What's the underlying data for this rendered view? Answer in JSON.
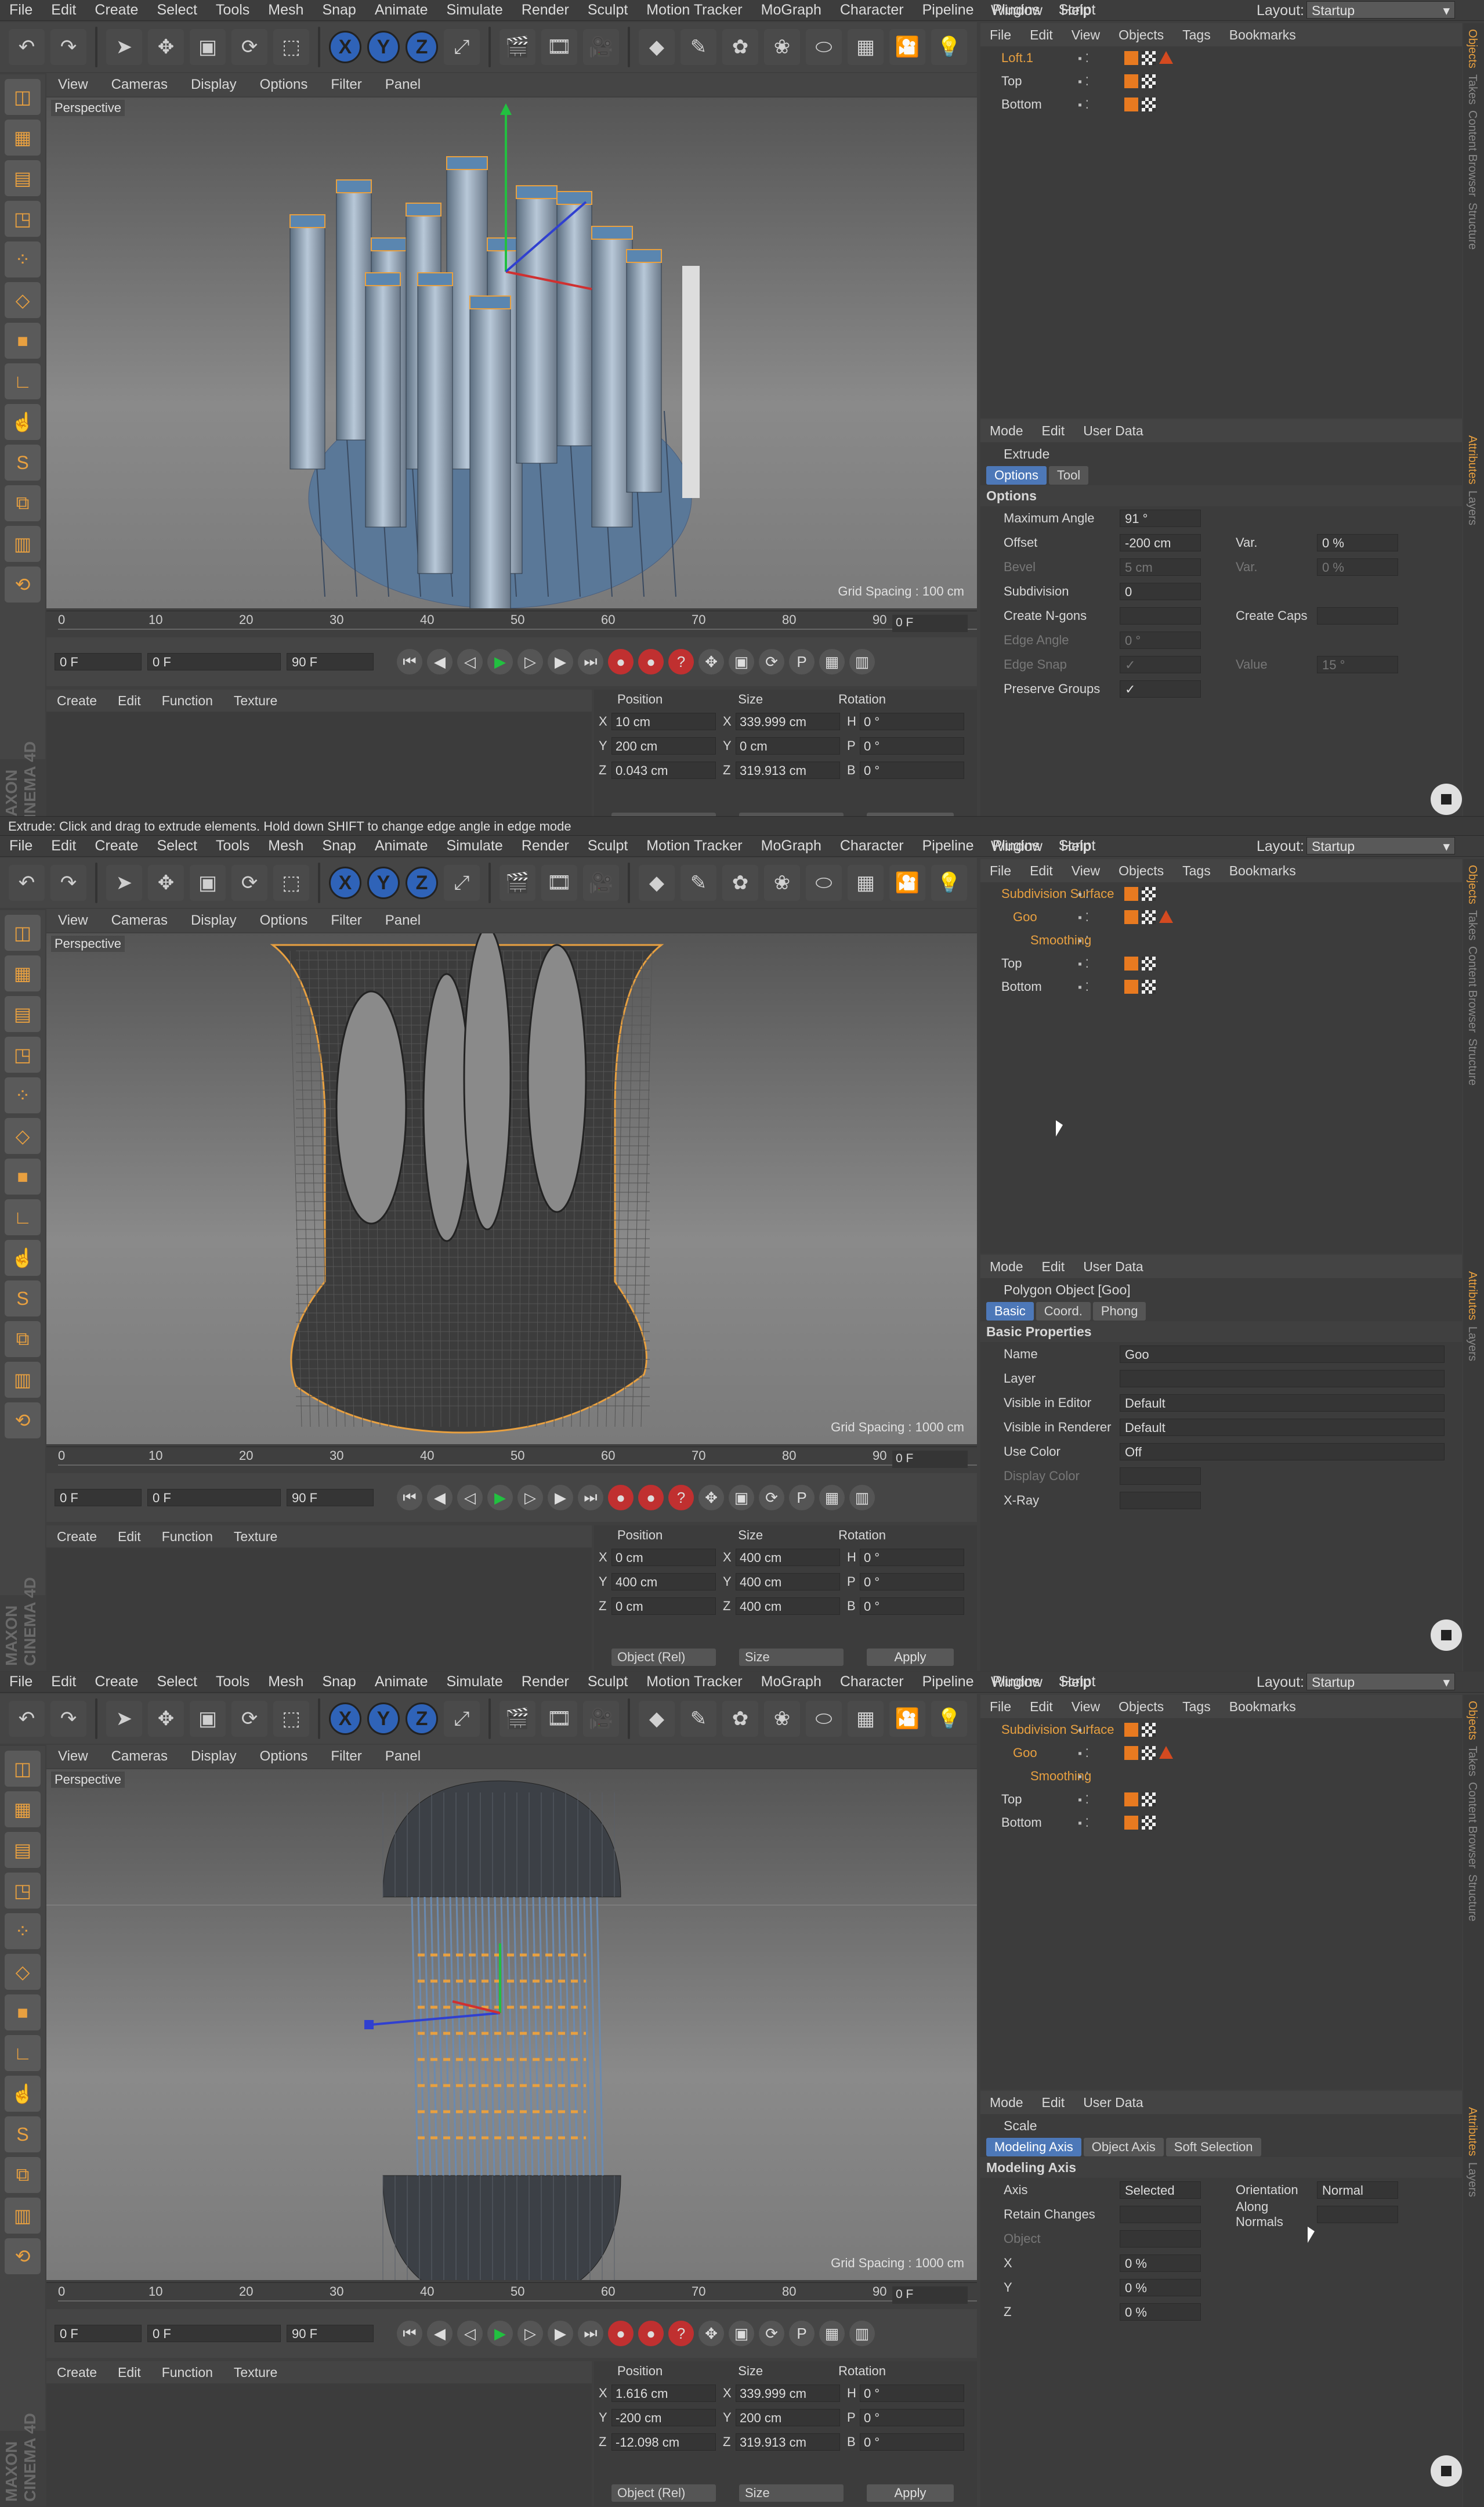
{
  "menu": [
    "File",
    "Edit",
    "Create",
    "Select",
    "Tools",
    "Mesh",
    "Snap",
    "Animate",
    "Simulate",
    "Render",
    "Sculpt",
    "Motion Tracker",
    "MoGraph",
    "Character",
    "Pipeline",
    "Plugins",
    "Script"
  ],
  "menu_right": [
    "Window",
    "Help"
  ],
  "layout_label": "Layout:",
  "layout_value": "Startup",
  "vp_menu": [
    "View",
    "Cameras",
    "Display",
    "Options",
    "Filter",
    "Panel"
  ],
  "vp_label": "Perspective",
  "obj_menu": [
    "File",
    "Edit",
    "View",
    "Objects",
    "Tags",
    "Bookmarks"
  ],
  "attr_menu": [
    "Mode",
    "Edit",
    "User Data"
  ],
  "mat_menu": [
    "Create",
    "Edit",
    "Function",
    "Texture"
  ],
  "coord_hdr": [
    "Position",
    "Size",
    "Rotation"
  ],
  "timeline_ticks": [
    "0",
    "10",
    "20",
    "30",
    "40",
    "50",
    "60",
    "70",
    "80",
    "90"
  ],
  "frame_end": "0 F",
  "transport": {
    "start": "0 F",
    "min": "0 F",
    "max": "90 F",
    "end": "90 F"
  },
  "apply": "Apply",
  "coord_mode": "Object (Rel)",
  "size_mode": "Size",
  "side_tabs": [
    "Objects",
    "Takes",
    "Content Browser",
    "Structure"
  ],
  "side_tabs2": [
    "Attributes",
    "Layers"
  ],
  "maxon": "MAXON CINEMA 4D",
  "status1": "Extrude: Click and drag to extrude elements. Hold down SHIFT to change edge angle in edge mode",
  "screens": [
    {
      "grid": "Grid Spacing : 100 cm",
      "objects": [
        {
          "name": "Loft.1",
          "color": "#e8a040"
        },
        {
          "name": "Top",
          "color": "#d8d8d8"
        },
        {
          "name": "Bottom",
          "color": "#d8d8d8"
        }
      ],
      "attr_title": "Extrude",
      "attr_tabs": [
        "Options",
        "Tool"
      ],
      "section": "Options",
      "rows": [
        {
          "label": "Maximum Angle",
          "value": "91 °"
        },
        {
          "label": "Offset",
          "value": "-200 cm",
          "label2": "Var.",
          "value2": "0 %"
        },
        {
          "label": "Bevel",
          "value": "5 cm",
          "label2": "Var.",
          "value2": "0 %",
          "dim": true
        },
        {
          "label": "Subdivision",
          "value": "0"
        },
        {
          "label": "Create N-gons",
          "value": "",
          "label2": "Create Caps",
          "value2": ""
        },
        {
          "label": "Edge Angle",
          "value": "0 °",
          "dim": true
        },
        {
          "label": "Edge Snap",
          "value": "✓",
          "label2": "Value",
          "value2": "15 °",
          "dim": true
        },
        {
          "label": "Preserve Groups",
          "value": "✓"
        }
      ],
      "coords": {
        "x": [
          "X",
          "10 cm",
          "X",
          "339.999 cm",
          "H",
          "0 °"
        ],
        "y": [
          "Y",
          "200 cm",
          "Y",
          "0 cm",
          "P",
          "0 °"
        ],
        "z": [
          "Z",
          "0.043 cm",
          "Z",
          "319.913 cm",
          "B",
          "0 °"
        ]
      }
    },
    {
      "grid": "Grid Spacing : 1000 cm",
      "objects": [
        {
          "name": "Subdivision Surface",
          "color": "#e8a040"
        },
        {
          "name": "Goo",
          "color": "#e8a040"
        },
        {
          "name": "Smoothing",
          "color": "#e8a040"
        },
        {
          "name": "Top",
          "color": "#d8d8d8"
        },
        {
          "name": "Bottom",
          "color": "#d8d8d8"
        }
      ],
      "attr_title": "Polygon Object [Goo]",
      "attr_tabs": [
        "Basic",
        "Coord.",
        "Phong"
      ],
      "section": "Basic Properties",
      "rows": [
        {
          "label": "Name",
          "value": "Goo"
        },
        {
          "label": "Layer",
          "value": ""
        },
        {
          "label": "Visible in Editor",
          "value": "Default"
        },
        {
          "label": "Visible in Renderer",
          "value": "Default"
        },
        {
          "label": "Use Color",
          "value": "Off"
        },
        {
          "label": "Display Color",
          "value": "",
          "dim": true
        },
        {
          "label": "X-Ray",
          "value": ""
        }
      ],
      "coords": {
        "x": [
          "X",
          "0 cm",
          "X",
          "400 cm",
          "H",
          "0 °"
        ],
        "y": [
          "Y",
          "400 cm",
          "Y",
          "400 cm",
          "P",
          "0 °"
        ],
        "z": [
          "Z",
          "0 cm",
          "Z",
          "400 cm",
          "B",
          "0 °"
        ]
      }
    },
    {
      "grid": "Grid Spacing : 1000 cm",
      "objects": [
        {
          "name": "Subdivision Surface",
          "color": "#e8a040"
        },
        {
          "name": "Goo",
          "color": "#e8a040"
        },
        {
          "name": "Smoothing",
          "color": "#e8a040"
        },
        {
          "name": "Top",
          "color": "#d8d8d8"
        },
        {
          "name": "Bottom",
          "color": "#d8d8d8"
        }
      ],
      "attr_title": "Scale",
      "attr_tabs": [
        "Modeling Axis",
        "Object Axis",
        "Soft Selection"
      ],
      "section": "Modeling Axis",
      "rows": [
        {
          "label": "Axis",
          "value": "Selected",
          "label2": "Orientation",
          "value2": "Normal"
        },
        {
          "label": "Retain Changes",
          "value": "",
          "label2": "Along Normals",
          "value2": ""
        },
        {
          "label": "Object",
          "value": "",
          "dim": true
        },
        {
          "label": "X",
          "value": "0 %"
        },
        {
          "label": "Y",
          "value": "0 %"
        },
        {
          "label": "Z",
          "value": "0 %"
        }
      ],
      "coords": {
        "x": [
          "X",
          "1.616 cm",
          "X",
          "339.999 cm",
          "H",
          "0 °"
        ],
        "y": [
          "Y",
          "-200 cm",
          "Y",
          "200 cm",
          "P",
          "0 °"
        ],
        "z": [
          "Z",
          "-12.098 cm",
          "Z",
          "319.913 cm",
          "B",
          "0 °"
        ]
      }
    }
  ]
}
